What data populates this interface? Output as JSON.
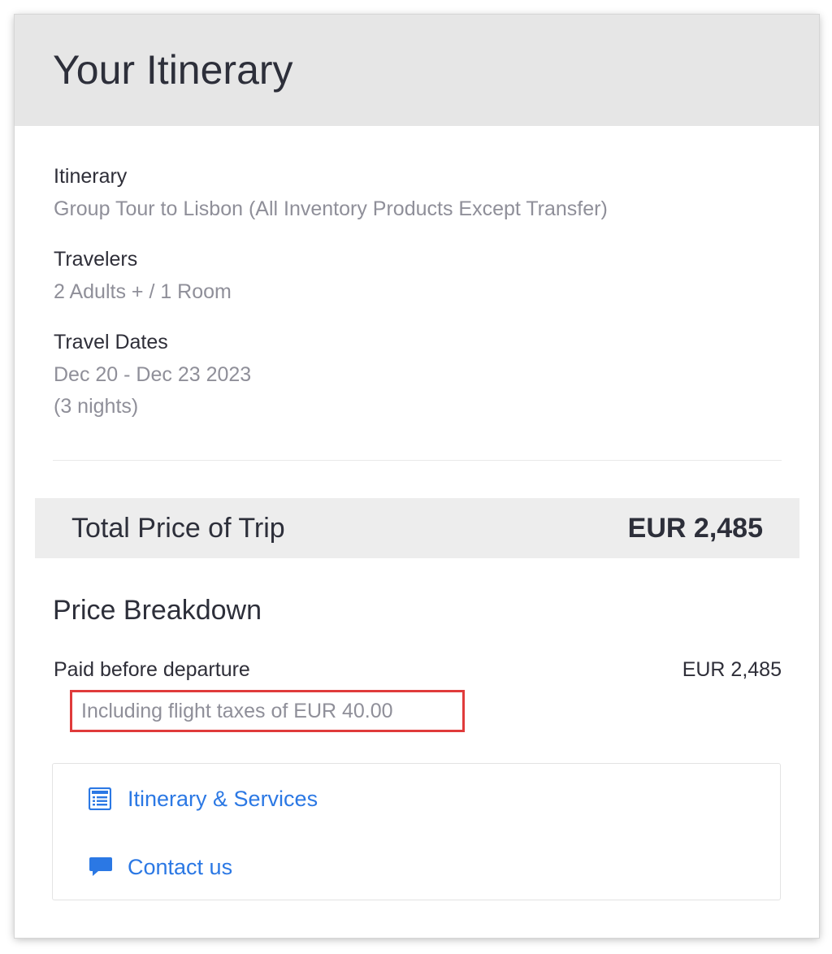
{
  "card": {
    "title": "Your Itinerary"
  },
  "details": {
    "itinerary": {
      "label": "Itinerary",
      "value": "Group Tour to Lisbon (All Inventory Products Except Transfer)"
    },
    "travelers": {
      "label": "Travelers",
      "value": "2 Adults + / 1 Room"
    },
    "travel_dates": {
      "label": "Travel Dates",
      "value": "Dec 20 - Dec 23 2023",
      "nights": "(3 nights)"
    }
  },
  "total": {
    "label": "Total Price of Trip",
    "amount": "EUR 2,485"
  },
  "breakdown": {
    "title": "Price Breakdown",
    "paid_label": "Paid before departure",
    "paid_amount": "EUR 2,485",
    "taxes_note": "Including flight taxes of EUR 40.00"
  },
  "links": [
    {
      "label": "Itinerary & Services",
      "icon": "document-list-icon"
    },
    {
      "label": "Contact us",
      "icon": "chat-bubble-icon"
    }
  ],
  "colors": {
    "header_bg": "#e6e6e6",
    "total_bar_bg": "#ededed",
    "link": "#2b78e4",
    "highlight_border": "#e03b3b",
    "muted_text": "#8f8f99",
    "primary_text": "#2d2f3a"
  }
}
